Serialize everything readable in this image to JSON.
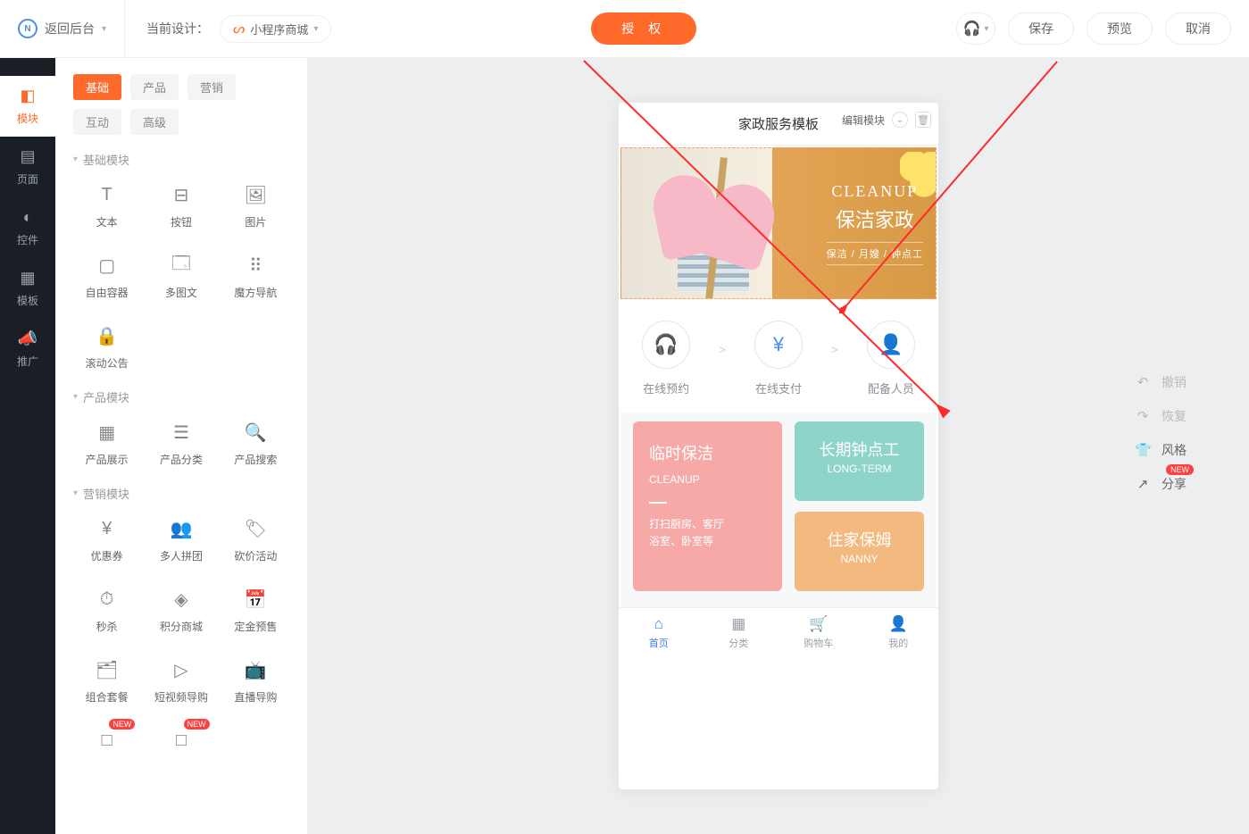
{
  "topbar": {
    "back": "返回后台",
    "design_label": "当前设计：",
    "design_value": "小程序商城",
    "auth_btn": "授 权",
    "save": "保存",
    "preview": "预览",
    "cancel": "取消"
  },
  "rail": [
    {
      "label": "模块",
      "icon": "◧"
    },
    {
      "label": "页面",
      "icon": "▤"
    },
    {
      "label": "控件",
      "icon": "◐"
    },
    {
      "label": "模板",
      "icon": "▦"
    },
    {
      "label": "推广",
      "icon": "📣"
    }
  ],
  "tabs": [
    "基础",
    "产品",
    "营销",
    "互动",
    "高级"
  ],
  "groups": [
    {
      "title": "基础模块",
      "items": [
        {
          "label": "文本",
          "icon": "T"
        },
        {
          "label": "按钮",
          "icon": "⊟"
        },
        {
          "label": "图片",
          "icon": "🖼"
        },
        {
          "label": "自由容器",
          "icon": "▢"
        },
        {
          "label": "多图文",
          "icon": "🗔"
        },
        {
          "label": "魔方导航",
          "icon": "⠿"
        },
        {
          "label": "滚动公告",
          "icon": "🔒"
        }
      ]
    },
    {
      "title": "产品模块",
      "items": [
        {
          "label": "产品展示",
          "icon": "▦"
        },
        {
          "label": "产品分类",
          "icon": "☰"
        },
        {
          "label": "产品搜索",
          "icon": "🔍"
        }
      ]
    },
    {
      "title": "营销模块",
      "items": [
        {
          "label": "优惠券",
          "icon": "¥"
        },
        {
          "label": "多人拼团",
          "icon": "👥"
        },
        {
          "label": "砍价活动",
          "icon": "🏷"
        },
        {
          "label": "秒杀",
          "icon": "⏱"
        },
        {
          "label": "积分商城",
          "icon": "◈"
        },
        {
          "label": "定金预售",
          "icon": "📅"
        },
        {
          "label": "组合套餐",
          "icon": "🗂"
        },
        {
          "label": "短视频导购",
          "icon": "▷"
        },
        {
          "label": "直播导购",
          "icon": "📺"
        },
        {
          "label": "",
          "icon": "□",
          "new": true
        },
        {
          "label": "",
          "icon": "□",
          "new": true
        }
      ]
    }
  ],
  "phone": {
    "title": "家政服务模板",
    "edit": "编辑模块",
    "banner": {
      "en": "CLEANUP",
      "cn": "保洁家政",
      "sub": "保洁 / 月嫂 / 钟点工"
    },
    "steps": [
      {
        "label": "在线预约",
        "icon": "🎧"
      },
      {
        "label": "在线支付",
        "icon": "¥"
      },
      {
        "label": "配备人员",
        "icon": "👤"
      }
    ],
    "cards": {
      "big": {
        "cn": "临时保洁",
        "en": "CLEANUP",
        "desc": "打扫厨房、客厅\n浴室、卧室等"
      },
      "green": {
        "cn": "长期钟点工",
        "en": "LONG-TERM"
      },
      "orange": {
        "cn": "住家保姆",
        "en": "NANNY"
      }
    },
    "tabbar": [
      {
        "label": "首页",
        "icon": "⌂"
      },
      {
        "label": "分类",
        "icon": "▦"
      },
      {
        "label": "购物车",
        "icon": "🛒"
      },
      {
        "label": "我的",
        "icon": "👤"
      }
    ]
  },
  "tools": [
    {
      "label": "撤销",
      "icon": "↶",
      "dark": false
    },
    {
      "label": "恢复",
      "icon": "↷",
      "dark": false
    },
    {
      "label": "风格",
      "icon": "👕",
      "dark": true
    },
    {
      "label": "分享",
      "icon": "↗",
      "dark": true,
      "new": "NEW"
    }
  ]
}
